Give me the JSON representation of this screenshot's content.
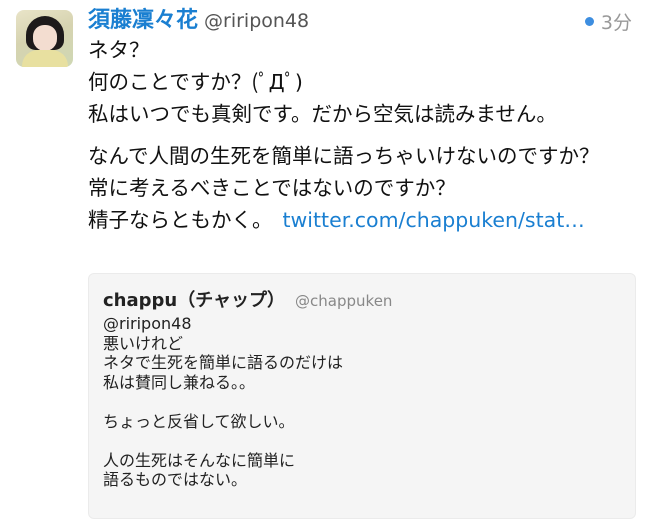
{
  "tweet": {
    "display_name": "須藤凜々花",
    "handle": "@riripon48",
    "time": "3分",
    "lines": [
      "ネタ？",
      "何のことですか？(ﾟДﾟ)",
      "私はいつでも真剣です。だから空気は読みません。",
      "なんで人間の生死を簡単に語っちゃいけないのですか？",
      "常に考えるべきことではないのですか？",
      "精子ならともかく。"
    ],
    "link": "twitter.com/chappuken/stat…"
  },
  "quote": {
    "display_name": "chappu（チャップ）",
    "handle": "@chappuken",
    "lines": [
      "@riripon48",
      "悪いけれど",
      "ネタで生死を簡単に語るのだけは",
      "私は賛同し兼ねる。。",
      "ちょっと反省して欲しい。",
      "人の生死はそんなに簡単に",
      "語るものではない。"
    ]
  },
  "colors": {
    "link_blue": "#1a7fd1",
    "unread_dot": "#3d8ee0",
    "quote_bg": "#f5f5f5"
  },
  "icons": {
    "avatar": "profile-photo",
    "status": "blue-dot-icon"
  }
}
